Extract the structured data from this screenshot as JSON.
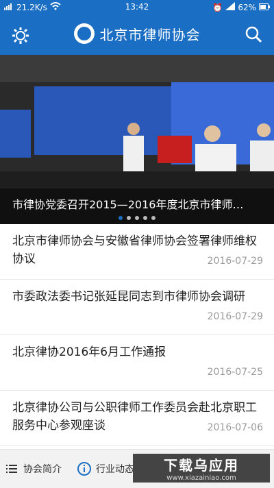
{
  "status_bar": {
    "network": "21.2K/s",
    "time": "13:42",
    "battery": "62%"
  },
  "header": {
    "title": "北京市律师协会",
    "logo_name": "lawyers-association-logo"
  },
  "banner": {
    "caption": "市律协党委召开2015—2016年度北京市律师…",
    "dots_count": 5,
    "active_dot": 1
  },
  "news": [
    {
      "title": "北京市律师协会与安徽省律师协会签署律师维权协议",
      "date": "2016-07-29"
    },
    {
      "title": "市委政法委书记张延昆同志到市律师协会调研",
      "date": "2016-07-29"
    },
    {
      "title": "北京律协2016年6月工作通报",
      "date": "2016-07-25"
    },
    {
      "title": "北京律协公司与公职律师工作委员会赴北京职工服务中心参观座谈",
      "date": "2016-07-06"
    }
  ],
  "tabs": [
    {
      "label": "协会简介",
      "icon": "list-icon"
    },
    {
      "label": "行业动态",
      "icon": "info-icon"
    }
  ],
  "watermark": {
    "title": "下载乌应用",
    "url": "www.xiazainiao.com"
  },
  "colors": {
    "primary": "#1a6fc4",
    "date": "#9a9a9a"
  }
}
